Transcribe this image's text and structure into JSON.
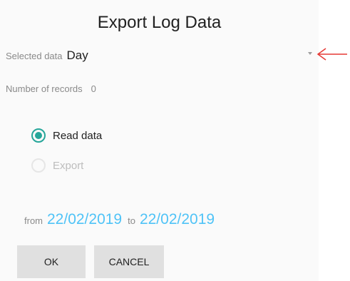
{
  "dialog": {
    "title": "Export Log Data",
    "selected_data_label": "Selected data",
    "selected_data_value": "Day",
    "number_of_records_label": "Number of records",
    "number_of_records_value": "0",
    "options": [
      {
        "label": "Read data",
        "selected": true
      },
      {
        "label": "Export",
        "selected": false,
        "enabled": false
      }
    ],
    "date_range": {
      "from_label": "from",
      "from_value": "22/02/2019",
      "to_label": "to",
      "to_value": "22/02/2019"
    },
    "buttons": {
      "ok_label": "OK",
      "cancel_label": "CANCEL"
    }
  },
  "colors": {
    "accent": "#26a69a",
    "date_text": "#4fc3f7",
    "annotation_arrow": "#e53935"
  },
  "icons": {
    "dropdown": "dropdown-caret-icon",
    "annotation": "red-arrow-icon"
  }
}
